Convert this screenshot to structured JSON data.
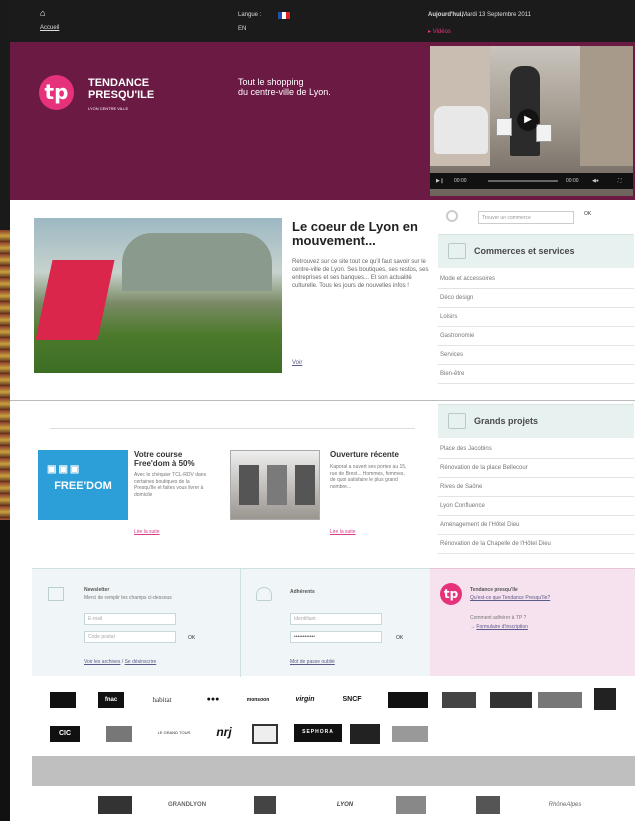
{
  "topbar": {
    "home_label": "Accueil",
    "lang_label": "Langue :",
    "lang_value": "EN",
    "today_label": "Aujourd'hui,",
    "date": "Mardi 13 Septembre 2011",
    "videos": "Vidéos"
  },
  "hero": {
    "logo_glyph": "tp",
    "brand_line1": "TENDANCE",
    "brand_line2": "PRESQU'ILE",
    "brand_sub": "LYON CENTRE VILLE",
    "tagline1": "Tout le shopping",
    "tagline2": "du centre-ville de Lyon.",
    "video_time_start": "00:00",
    "video_time_end": "00:00"
  },
  "feature": {
    "title": "Le coeur de Lyon en mouvement...",
    "body": "Retrouvez sur ce site tout ce qu'il faut savoir sur le centre-ville de Lyon. Ses boutiques, ses restos, ses entreprises et ses banques... Et son actualité culturelle. Tous les jours de nouvelles infos !",
    "more": "Voir"
  },
  "sidebar": {
    "search_placeholder": "Trouver un commerce",
    "search_ok": "OK",
    "commerces_title": "Commerces et services",
    "commerces": [
      "Mode et accessoires",
      "Déco design",
      "Loisirs",
      "Gastronomie",
      "Services",
      "Bien-être"
    ],
    "projets_title": "Grands projets",
    "projets": [
      "Place des Jacobins",
      "Rénovation de la place Bellecour",
      "Rives de Saône",
      "Lyon Confluence",
      "Aménagement de l'Hôtel Dieu",
      "Rénovation de la Chapelle de l'Hôtel Dieu"
    ]
  },
  "promos": [
    {
      "title": "Votre course Free'dom à 50%",
      "body": "Avec le chéquier TCL-RDV dans certaines boutiques de la Presqu'île et faites vous livrer à domicile",
      "link": "Lire la suite",
      "image_text": "FREE'DOM"
    },
    {
      "title": "Ouverture récente",
      "body": "Kaporal a ouvert ses portes au 15, rue de Brest... Hommes, femmes, de quoi satisfaire le plus grand nombre...",
      "link": "Lire la suite"
    }
  ],
  "newsletter": {
    "title": "Newsletter",
    "sub": "Merci de remplir les champs ci-dessous",
    "email_placeholder": "E-mail",
    "postal_placeholder": "Code postal",
    "ok": "OK",
    "archives": "Voir les archives",
    "unsubscribe": "Se désinscrire"
  },
  "adherents": {
    "title": "Adhérents",
    "id_placeholder": "Identifiant",
    "password_value": "••••••••••••",
    "ok": "OK",
    "forgot": "Mot de passe oublié"
  },
  "tp_box": {
    "logo_glyph": "tp",
    "title": "Tendance presqu'île",
    "link1": "Qu'est-ce que Tendance Presqu'île?",
    "text2": "Comment adhérer à TP ?",
    "link2": "Formulaire d'inscription"
  },
  "logos_row1": [
    "",
    "fnac",
    "habitat",
    "",
    "monsoon",
    "virgin",
    "SNCF",
    "",
    "",
    "",
    "",
    ""
  ],
  "logos_row2": [
    "CIC",
    "",
    "LE GRAND TOUR",
    "nrj",
    "",
    "SEPHORA",
    "",
    ""
  ],
  "partners": [
    "",
    "GRANDLYON",
    "",
    "LYON",
    "",
    "",
    "RhôneAlpes"
  ],
  "colors": {
    "brand": "#6b1a44",
    "accent": "#e6327a",
    "link_pink": "#d43e8c"
  }
}
